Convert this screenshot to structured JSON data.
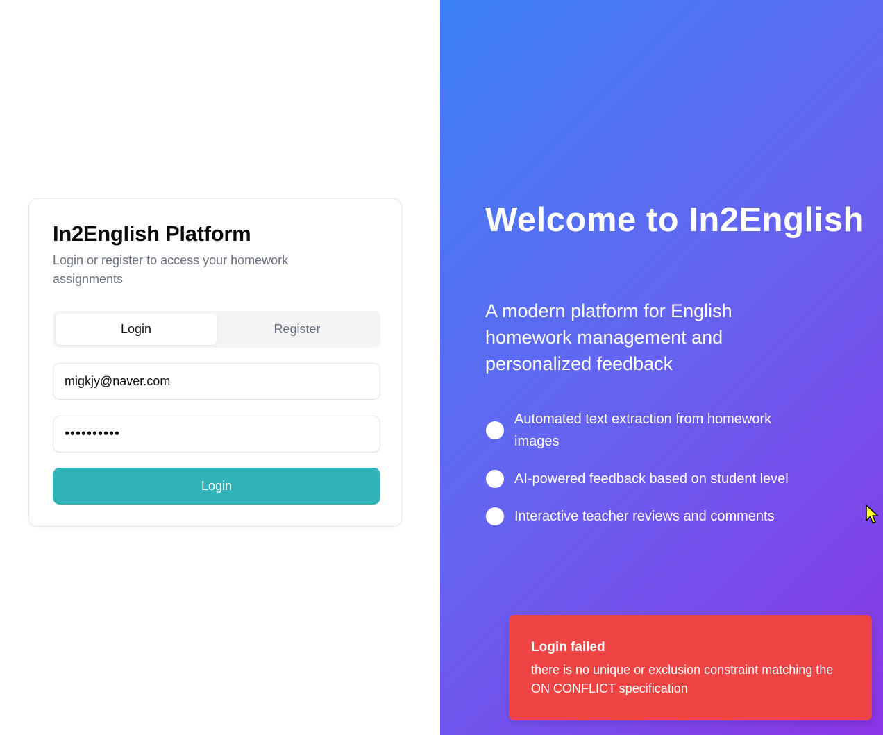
{
  "login_card": {
    "title": "In2English Platform",
    "description": "Login or register to access your homework assignments",
    "tabs": [
      {
        "label": "Login",
        "active": true
      },
      {
        "label": "Register",
        "active": false
      }
    ],
    "email": {
      "value": "migkjy@naver.com"
    },
    "password": {
      "value": "••••••••••"
    },
    "submit_label": "Login"
  },
  "hero": {
    "title": "Welcome to In2English",
    "subtitle": "A modern platform for English homework management and personalized feedback",
    "features": [
      {
        "text": "Automated text extraction from homework images"
      },
      {
        "text": "AI-powered feedback based on student level"
      },
      {
        "text": "Interactive teacher reviews and comments"
      }
    ]
  },
  "toast": {
    "title": "Login failed",
    "message": "there is no unique or exclusion constraint matching the ON CONFLICT specification"
  },
  "colors": {
    "accent": "#2fb3b8",
    "gradient_start": "#3b82f6",
    "gradient_end": "#8b35e6",
    "error": "#ef4444"
  }
}
